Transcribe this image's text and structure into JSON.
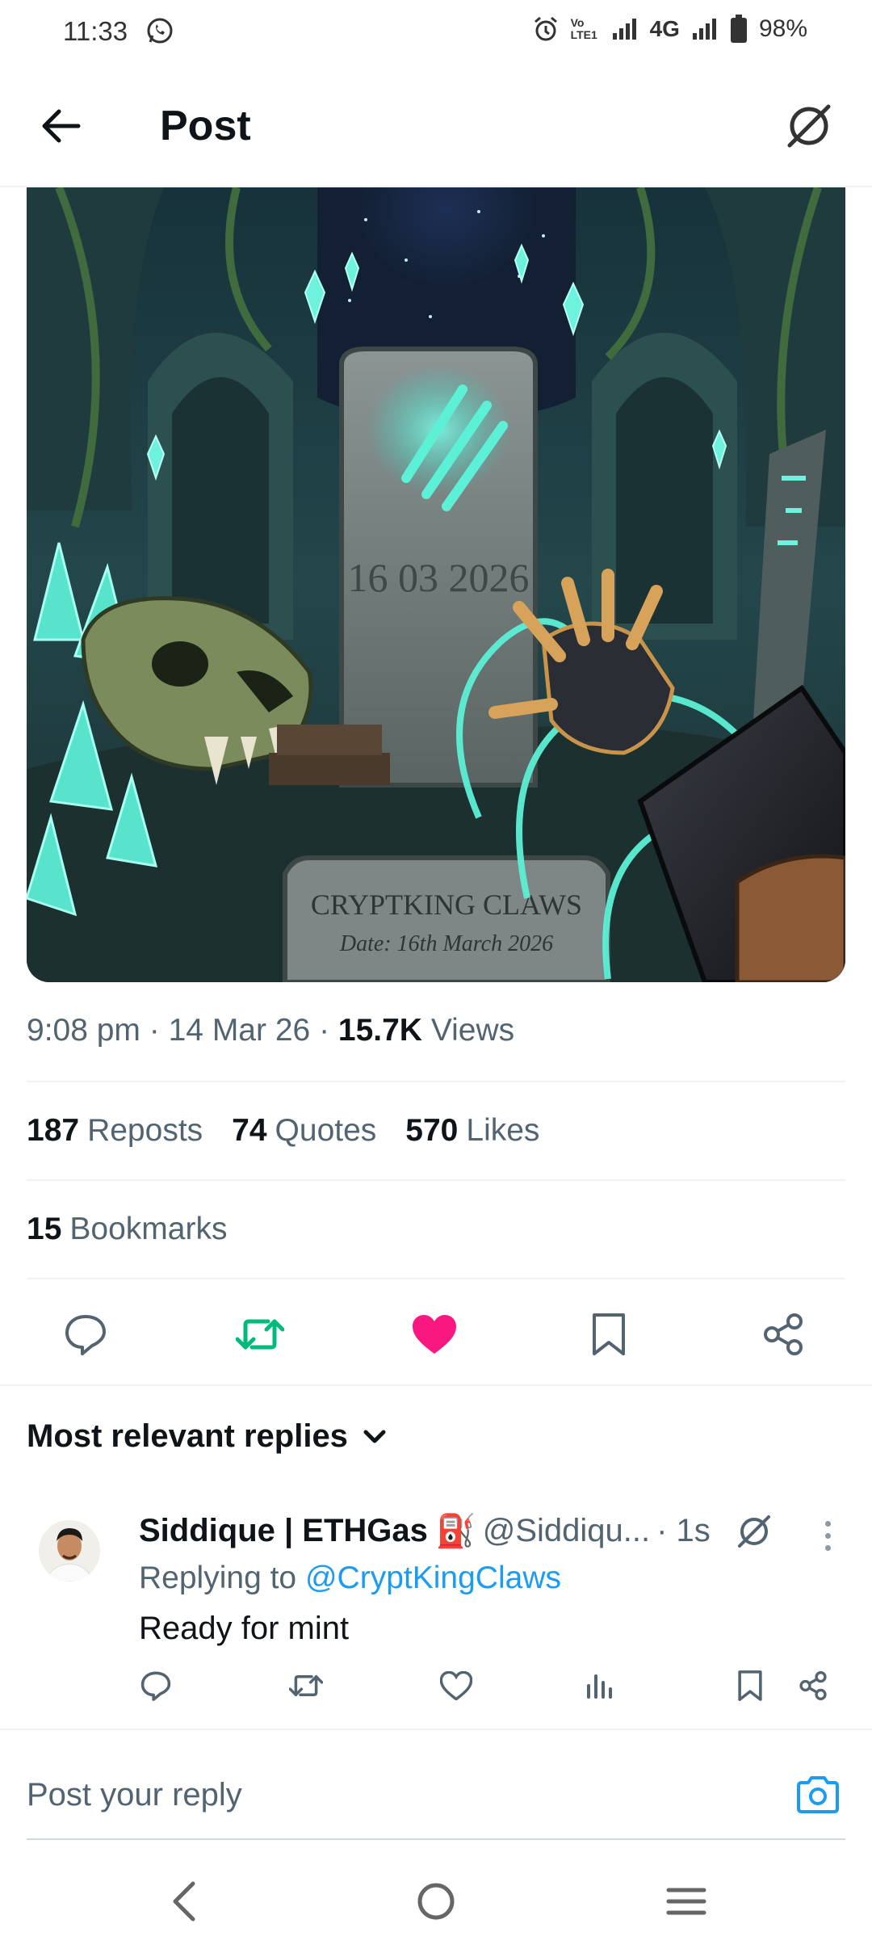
{
  "status_bar": {
    "time": "11:33",
    "network_label": "4G",
    "volte_label": "Vo LTE1",
    "battery": "98%"
  },
  "header": {
    "title": "Post",
    "back_icon": "arrow-left-icon",
    "grok_icon": "grok-icon"
  },
  "post": {
    "image_alt": "Illustration: tomb with claw marks",
    "image_text": {
      "headstone_date": "16 03 2026",
      "plaque_title": "CRYPTKING CLAWS",
      "plaque_subtitle": "Date: 16th March 2026"
    },
    "meta": {
      "time": "9:08 pm",
      "separator": "·",
      "date": "14 Mar 26",
      "views_count": "15.7K",
      "views_label": "Views"
    },
    "stats": {
      "reposts_count": "187",
      "reposts_label": "Reposts",
      "quotes_count": "74",
      "quotes_label": "Quotes",
      "likes_count": "570",
      "likes_label": "Likes",
      "bookmarks_count": "15",
      "bookmarks_label": "Bookmarks"
    },
    "actions": [
      "reply-icon",
      "repost-icon",
      "like-icon",
      "bookmark-icon",
      "share-icon"
    ]
  },
  "colors": {
    "repost_active": "#00ba7c",
    "like_active": "#f91880",
    "link": "#1d9bf0",
    "secondary_text": "#536471"
  },
  "replies": {
    "sort_label": "Most relevant replies",
    "items": [
      {
        "name": "Siddique | ETHGas",
        "badge": "⛽",
        "handle": "@Siddiqu...",
        "time": "· 1s",
        "replying_prefix": "Replying to",
        "replying_to": "@CryptKingClaws",
        "text": "Ready for mint"
      }
    ]
  },
  "compose": {
    "placeholder": "Post your reply",
    "camera_icon": "camera-icon"
  },
  "navbar": [
    "back-nav-icon",
    "home-nav-icon",
    "recents-nav-icon"
  ]
}
